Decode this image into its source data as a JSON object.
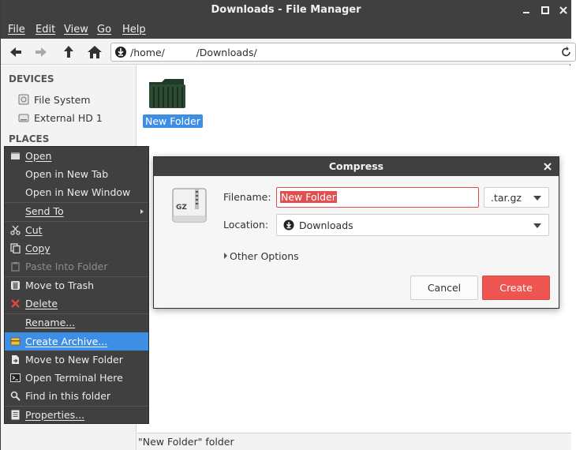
{
  "window": {
    "title": "Downloads - File Manager"
  },
  "menubar": {
    "items": [
      "File",
      "Edit",
      "View",
      "Go",
      "Help"
    ]
  },
  "pathbar": {
    "path": "/home/          /Downloads/"
  },
  "sidebar": {
    "devices_header": "DEVICES",
    "devices": [
      "File System",
      "External HD 1"
    ],
    "places_header": "PLACES"
  },
  "content": {
    "folder_name": "New Folder"
  },
  "statusbar": {
    "text": "\"New Folder\" folder"
  },
  "context_menu": {
    "items": [
      {
        "label": "Open",
        "icon": "open-icon"
      },
      {
        "label": "Open in New Tab",
        "icon": ""
      },
      {
        "label": "Open in New Window",
        "icon": ""
      },
      {
        "label": "Send To",
        "icon": ""
      },
      {
        "label": "Cut",
        "icon": "scissors-icon"
      },
      {
        "label": "Copy",
        "icon": "copy-icon"
      },
      {
        "label": "Paste Into Folder",
        "icon": "paste-icon"
      },
      {
        "label": "Move to Trash",
        "icon": "trash-icon"
      },
      {
        "label": "Delete",
        "icon": "delete-icon"
      },
      {
        "label": "Rename...",
        "icon": ""
      },
      {
        "label": "Create Archive...",
        "icon": "archive-icon"
      },
      {
        "label": "Move to New Folder",
        "icon": "move-folder-icon"
      },
      {
        "label": "Open Terminal Here",
        "icon": "terminal-icon"
      },
      {
        "label": "Find in this folder",
        "icon": "search-icon"
      },
      {
        "label": "Properties...",
        "icon": "properties-icon"
      }
    ],
    "highlighted": "Create Archive...",
    "disabled": [
      "Paste Into Folder"
    ]
  },
  "dialog": {
    "title": "Compress",
    "filename_label": "Filename:",
    "filename_value": "New Folder",
    "extension": ".tar.gz",
    "location_label": "Location:",
    "location_value": "Downloads",
    "other_options": "Other Options",
    "cancel_label": "Cancel",
    "create_label": "Create",
    "archive_icon_text": "GZ"
  },
  "colors": {
    "titlebar": "#404040",
    "selection": "#3d8fe6",
    "accent": "#ee5550"
  }
}
